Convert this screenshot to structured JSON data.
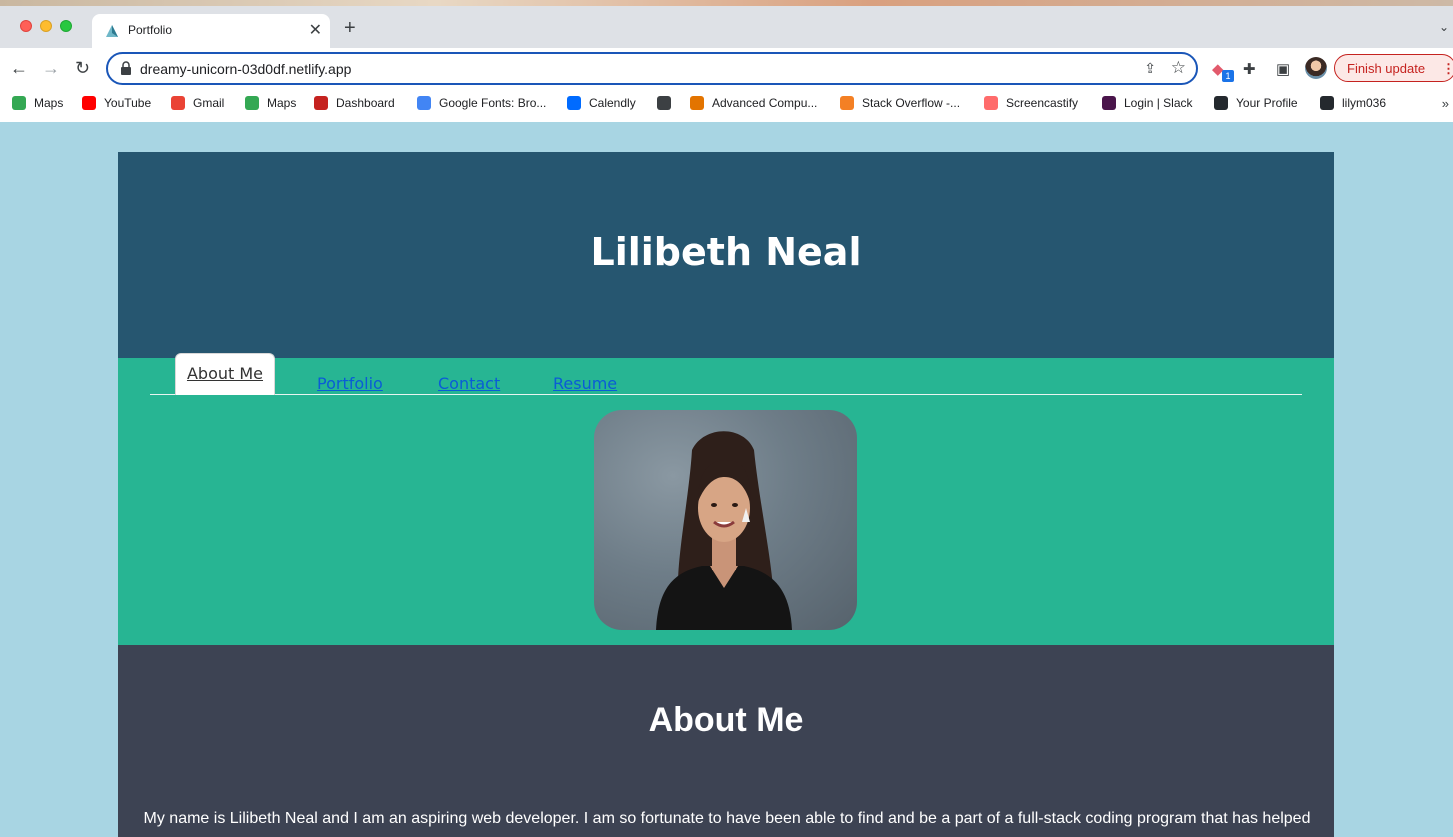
{
  "browser": {
    "tab_title": "Portfolio",
    "url": "dreamy-unicorn-03d0df.netlify.app",
    "update_label": "Finish update",
    "extension_badge": "1",
    "bookmarks": [
      {
        "label": "Maps",
        "color": "#34a853"
      },
      {
        "label": "YouTube",
        "color": "#ff0000"
      },
      {
        "label": "Gmail",
        "color": "#ea4335"
      },
      {
        "label": "Maps",
        "color": "#34a853"
      },
      {
        "label": "Dashboard",
        "color": "#c5221f"
      },
      {
        "label": "Google Fonts: Bro...",
        "color": "#4285f4"
      },
      {
        "label": "Calendly",
        "color": "#006bff"
      },
      {
        "label": "",
        "color": "#3c4043"
      },
      {
        "label": "Advanced Compu...",
        "color": "#e37400"
      },
      {
        "label": "Stack Overflow -...",
        "color": "#f48024"
      },
      {
        "label": "Screencastify",
        "color": "#ff6b6b"
      },
      {
        "label": "Login | Slack",
        "color": "#4a154b"
      },
      {
        "label": "Your Profile",
        "color": "#24292e"
      },
      {
        "label": "lilym036",
        "color": "#24292e"
      }
    ]
  },
  "site": {
    "name": "Lilibeth Neal",
    "nav": {
      "about": "About Me",
      "portfolio": "Portfolio",
      "contact": "Contact",
      "resume": "Resume"
    },
    "about": {
      "heading": "About Me",
      "text": "My name is Lilibeth Neal and I am an aspiring web developer. I am so fortunate to have been able to find and be a part of a full-stack coding program that has helped"
    },
    "colors": {
      "hero": "#265670",
      "nav_band": "#27b593",
      "about_bg": "#3d4353",
      "page_bg": "#a8d5e3"
    }
  }
}
